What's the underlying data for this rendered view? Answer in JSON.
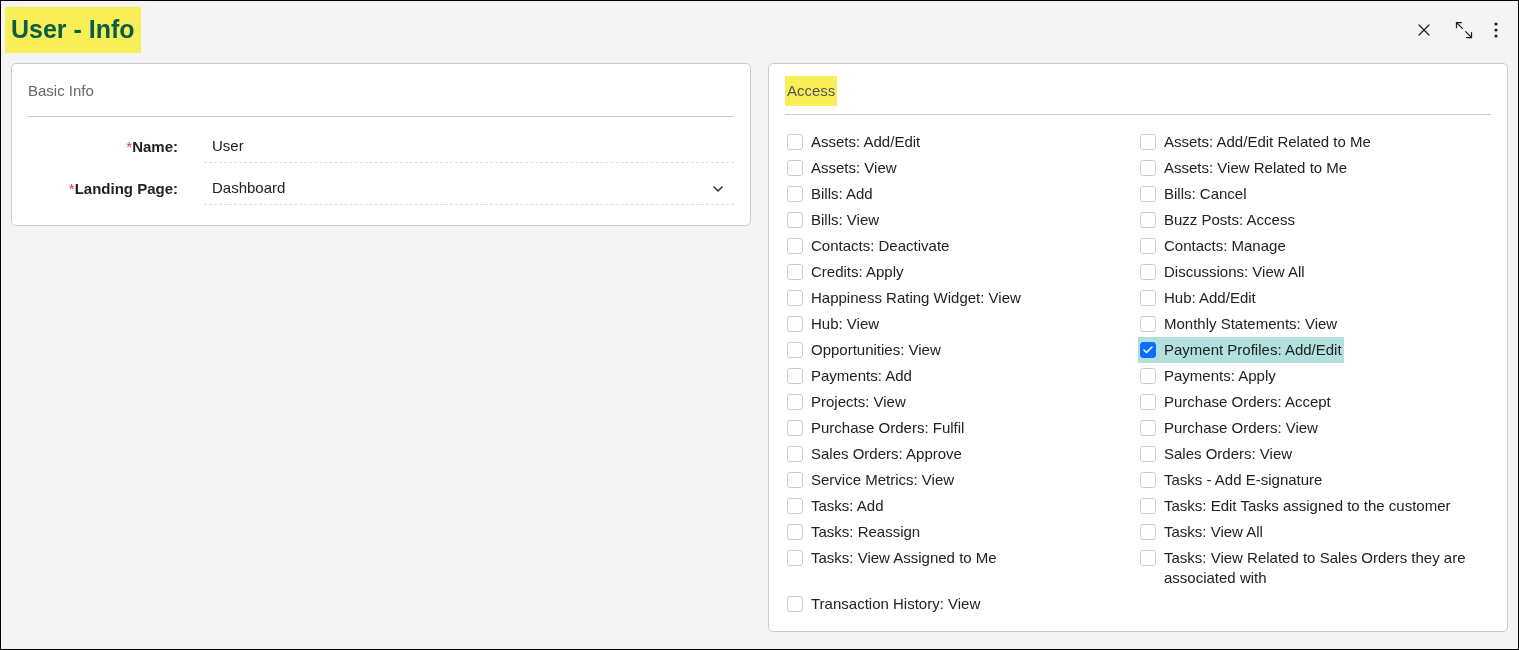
{
  "title": "User - Info",
  "basic_info": {
    "heading": "Basic Info",
    "fields": [
      {
        "kind": "text",
        "required_mark": "*",
        "label": "Name:",
        "value": "User"
      },
      {
        "kind": "select",
        "required_mark": "*",
        "label": "Landing Page:",
        "value": "Dashboard"
      }
    ]
  },
  "access": {
    "heading": "Access",
    "permissions": [
      {
        "label": "Assets: Add/Edit",
        "checked": false
      },
      {
        "label": "Assets: Add/Edit Related to Me",
        "checked": false
      },
      {
        "label": "Assets: View",
        "checked": false
      },
      {
        "label": "Assets: View Related to Me",
        "checked": false
      },
      {
        "label": "Bills: Add",
        "checked": false
      },
      {
        "label": "Bills: Cancel",
        "checked": false
      },
      {
        "label": "Bills: View",
        "checked": false
      },
      {
        "label": "Buzz Posts: Access",
        "checked": false
      },
      {
        "label": "Contacts: Deactivate",
        "checked": false
      },
      {
        "label": "Contacts: Manage",
        "checked": false
      },
      {
        "label": "Credits: Apply",
        "checked": false
      },
      {
        "label": "Discussions: View All",
        "checked": false
      },
      {
        "label": "Happiness Rating Widget: View",
        "checked": false
      },
      {
        "label": "Hub: Add/Edit",
        "checked": false
      },
      {
        "label": "Hub: View",
        "checked": false
      },
      {
        "label": "Monthly Statements: View",
        "checked": false
      },
      {
        "label": "Opportunities: View",
        "checked": false
      },
      {
        "label": "Payment Profiles: Add/Edit",
        "checked": true
      },
      {
        "label": "Payments: Add",
        "checked": false
      },
      {
        "label": "Payments: Apply",
        "checked": false
      },
      {
        "label": "Projects: View",
        "checked": false
      },
      {
        "label": "Purchase Orders: Accept",
        "checked": false
      },
      {
        "label": "Purchase Orders: Fulfil",
        "checked": false
      },
      {
        "label": "Purchase Orders: View",
        "checked": false
      },
      {
        "label": "Sales Orders: Approve",
        "checked": false
      },
      {
        "label": "Sales Orders: View",
        "checked": false
      },
      {
        "label": "Service Metrics: View",
        "checked": false
      },
      {
        "label": "Tasks - Add E-signature",
        "checked": false
      },
      {
        "label": "Tasks: Add",
        "checked": false
      },
      {
        "label": "Tasks: Edit Tasks assigned to the customer",
        "checked": false
      },
      {
        "label": "Tasks: Reassign",
        "checked": false
      },
      {
        "label": "Tasks: View All",
        "checked": false
      },
      {
        "label": "Tasks: View Assigned to Me",
        "checked": false
      },
      {
        "label": "Tasks: View Related to Sales Orders they are associated with",
        "checked": false
      },
      {
        "label": "Transaction History: View",
        "checked": false
      }
    ]
  }
}
